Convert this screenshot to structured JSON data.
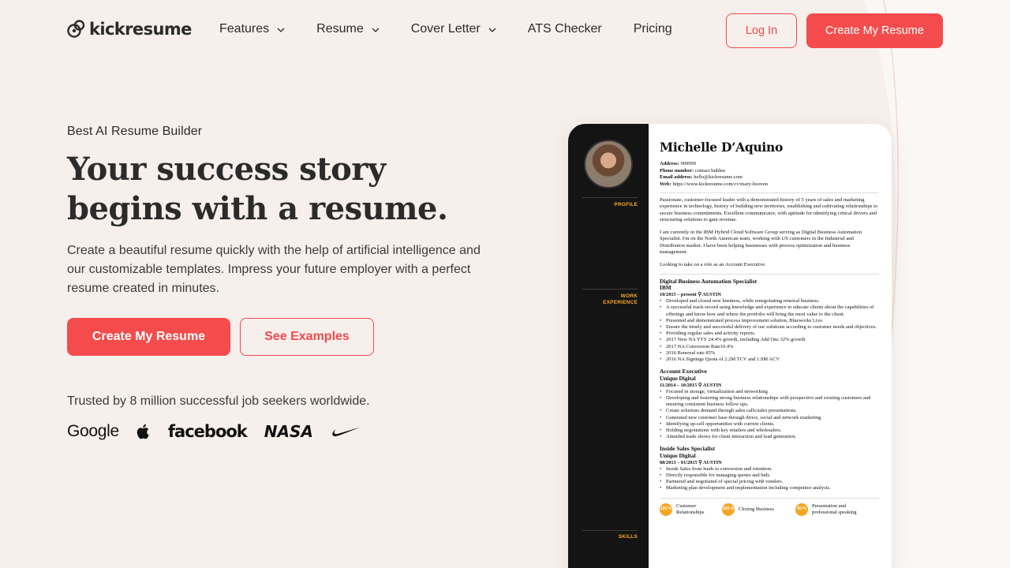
{
  "header": {
    "logo_text": "kickresume",
    "nav": [
      {
        "label": "Features",
        "has_dropdown": true
      },
      {
        "label": "Resume",
        "has_dropdown": true
      },
      {
        "label": "Cover Letter",
        "has_dropdown": true
      },
      {
        "label": "ATS Checker",
        "has_dropdown": false
      },
      {
        "label": "Pricing",
        "has_dropdown": false
      }
    ],
    "login_label": "Log In",
    "create_label": "Create My Resume"
  },
  "hero": {
    "eyebrow": "Best AI Resume Builder",
    "headline_line1": "Your success story",
    "headline_line2": "begins with a resume.",
    "subtext": "Create a beautiful resume quickly with the help of artificial intelligence and our customizable templates. Impress your future employer with a perfect resume created in minutes.",
    "cta_primary": "Create My Resume",
    "cta_secondary": "See Examples",
    "trusted": "Trusted by 8 million successful job seekers worldwide.",
    "brands": {
      "google": "Google",
      "apple": "apple-logo",
      "facebook": "facebook",
      "nasa": "NASA",
      "nike": "nike-swoosh"
    }
  },
  "resume": {
    "name": "Michelle D’Aquino",
    "contact": {
      "address_label": "Address:",
      "address": "909999",
      "phone_label": "Phone number:",
      "phone": "contact hidden",
      "email_label": "Email address:",
      "email": "hello@kickresume.com",
      "web_label": "Web:",
      "web": "https://www.kickresume.com/cv/mary-hooven"
    },
    "side_labels": {
      "profile": "PROFILE",
      "work_1": "WORK",
      "work_2": "EXPERIENCE",
      "skills": "SKILLS"
    },
    "profile_paras": [
      "Passionate, customer-focused leader with a demonstrated history of 5 years of sales and marketing experience in technology, history of building new territories, establishing and cultivating relationships to secure business commitments. Excellent communicator, with aptitude for identifying critical drivers and structuring solutions to gain revenue.",
      "I am currently in the IBM Hybrid Cloud Software Group serving as Digital Business Automation Specialist. I'm on the North American team, working with US customers in the Industrial and Distribution market. I have been helping businesses with process optimization and business management.",
      "Looking to take on a role as an Account Executive."
    ],
    "jobs": [
      {
        "title": "Digital Business Automation Specialist",
        "company": "IBM",
        "meta": "10/2015 – present ⚲ AUSTIN",
        "bullets": [
          "Developed and closed new business, while renegotiating renewal business.",
          "A successful track-record using knowledge and experience  to educate clients about the capabilities of offerings and know how and where the portfolio will bring the most value to the client.",
          "Presented and demonstrated process improvement solution, Blueworks Live.",
          "Ensure the timely and successful delivery of our solutions according to customer needs and objectives.",
          "Providing regular sales and activity reports.",
          "2017 New NA YTY 24.4% growth, including Add Ons 32% growth",
          "2017 NA Conversion Rate10.4%",
          "2016 Renewal rate 85%",
          "2016 NA Signings Quota of 2.2M TCV and 1.9M ACV"
        ]
      },
      {
        "title": "Account Executive",
        "company": "Unique Digital",
        "meta": "11/2014 – 10/2015 ⚲ AUSTIN",
        "bullets": [
          "Focused in storage, virtualization and networking",
          "Developing and fostering strong business relationships with prospective and existing customers and ensuring consistent business follow ups.",
          "Create solutions demand through sales calls/sales presentations.",
          "Generated new customer base through direct, social and network marketing",
          "Identifying up-sell opportunities with current clients.",
          "Holding negotiations with key retailers and wholesalers.",
          "Attended trade shows for client interaction and lead generation."
        ]
      },
      {
        "title": "Inside Sales Specialist",
        "company": "Unique Digital",
        "meta": "08/2013 – 01/2015 ⚲ AUSTIN",
        "bullets": [
          "Inside Sales from leads to conversion and retention.",
          "Directly responsible for managing quotes and bids.",
          "Partnered and negotiated of special pricing with vendors.",
          "Marketing plan development and implementation including competitor analysis."
        ]
      }
    ],
    "skills": [
      {
        "level": "100 %",
        "label": "Customer Relationships"
      },
      {
        "level": "100 %",
        "label": "Closing Business"
      },
      {
        "level": "90 %",
        "label": "Presentation and professional speaking"
      }
    ]
  }
}
